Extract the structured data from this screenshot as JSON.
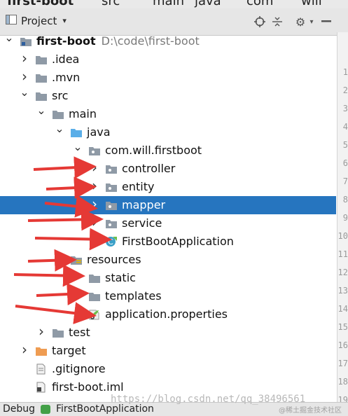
{
  "breadcrumb": [
    "first-boot",
    "src",
    "main",
    "java",
    "com",
    "will"
  ],
  "header": {
    "title": "Project"
  },
  "tree": [
    {
      "label": "first-boot",
      "path": "D:\\code\\first-boot",
      "bold": true,
      "icon": "module-folder-icon",
      "depth": 0,
      "chev": "down"
    },
    {
      "label": ".idea",
      "icon": "folder-icon",
      "depth": 1,
      "chev": "right"
    },
    {
      "label": ".mvn",
      "icon": "folder-icon",
      "depth": 1,
      "chev": "right"
    },
    {
      "label": "src",
      "icon": "folder-icon",
      "depth": 1,
      "chev": "down"
    },
    {
      "label": "main",
      "icon": "folder-icon",
      "depth": 2,
      "chev": "down"
    },
    {
      "label": "java",
      "icon": "source-folder-icon",
      "depth": 3,
      "chev": "down"
    },
    {
      "label": "com.will.firstboot",
      "icon": "package-icon",
      "depth": 4,
      "chev": "down"
    },
    {
      "label": "controller",
      "icon": "package-icon",
      "depth": 5,
      "chev": "right"
    },
    {
      "label": "entity",
      "icon": "package-icon",
      "depth": 5,
      "chev": "right"
    },
    {
      "label": "mapper",
      "icon": "package-icon",
      "depth": 5,
      "chev": "right",
      "selected": true
    },
    {
      "label": "service",
      "icon": "package-icon",
      "depth": 5,
      "chev": "right"
    },
    {
      "label": "FirstBootApplication",
      "icon": "spring-boot-class-icon",
      "depth": 5,
      "chev": ""
    },
    {
      "label": "resources",
      "icon": "resources-folder-icon",
      "depth": 3,
      "chev": "down"
    },
    {
      "label": "static",
      "icon": "folder-icon",
      "depth": 4,
      "chev": ""
    },
    {
      "label": "templates",
      "icon": "folder-icon",
      "depth": 4,
      "chev": ""
    },
    {
      "label": "application.properties",
      "icon": "spring-properties-icon",
      "depth": 4,
      "chev": ""
    },
    {
      "label": "test",
      "icon": "folder-icon",
      "depth": 2,
      "chev": "right"
    },
    {
      "label": "target",
      "icon": "excluded-folder-icon",
      "depth": 1,
      "chev": "right"
    },
    {
      "label": ".gitignore",
      "icon": "file-icon",
      "depth": 1,
      "chev": ""
    },
    {
      "label": "first-boot.iml",
      "icon": "iml-file-icon",
      "depth": 1,
      "chev": ""
    }
  ],
  "gutter_numbers": [
    "1",
    "2",
    "3",
    "4",
    "5",
    "6",
    "7",
    "8",
    "9",
    "10",
    "11",
    "12",
    "13",
    "14",
    "15",
    "16",
    "17",
    "18",
    "19"
  ],
  "bottom": {
    "debug_label": "Debug",
    "app_label": "FirstBootApplication"
  },
  "watermark": "https://blog.csdn.net/qq_38496561",
  "watermark2": "@稀土掘金技术社区",
  "colors": {
    "selection": "#2675bf",
    "arrow": "#e53935",
    "folder": "#8f9aa6",
    "source_folder": "#5aaee8",
    "excluded_folder": "#ef9c52"
  }
}
